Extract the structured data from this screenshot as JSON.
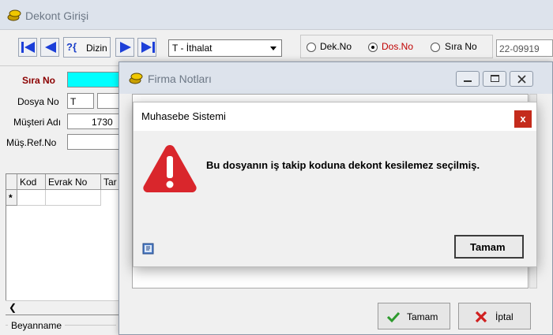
{
  "main_window": {
    "title": "Dekont Girişi"
  },
  "toolbar": {
    "dizin_label": "Dizin",
    "dizin_prefix": "?{",
    "import_type": "T - İthalat",
    "radio": {
      "dek_no": "Dek.No",
      "dos_no": "Dos.No",
      "sira_no": "Sıra No",
      "selected": "dos_no"
    },
    "dosno_value": "22-09919"
  },
  "form": {
    "sira_no_label": "Sıra No",
    "dosya_no_label": "Dosya No",
    "dosya_no_value": "T",
    "musteri_adi_label": "Müşteri Adı",
    "musteri_adi_value": "1730",
    "mus_ref_no_label": "Müş.Ref.No"
  },
  "grid": {
    "headers": [
      "Kod",
      "Evrak No",
      "Tar"
    ],
    "new_row_marker": "*"
  },
  "beyanname_label": "Beyanname",
  "firma_notlari": {
    "title": "Firma Notları",
    "ok_label": "Tamam",
    "cancel_label": "İptal"
  },
  "message_dialog": {
    "title": "Muhasebe Sistemi",
    "message": "Bu dosyanın iş takip koduna dekont kesilemez seçilmiş.",
    "ok_label": "Tamam",
    "close_glyph": "x"
  },
  "colors": {
    "sira_no_field": "#00ffff",
    "error_icon": "#d9262c",
    "title_text": "#6d7886",
    "close_button": "#c42b1c"
  }
}
